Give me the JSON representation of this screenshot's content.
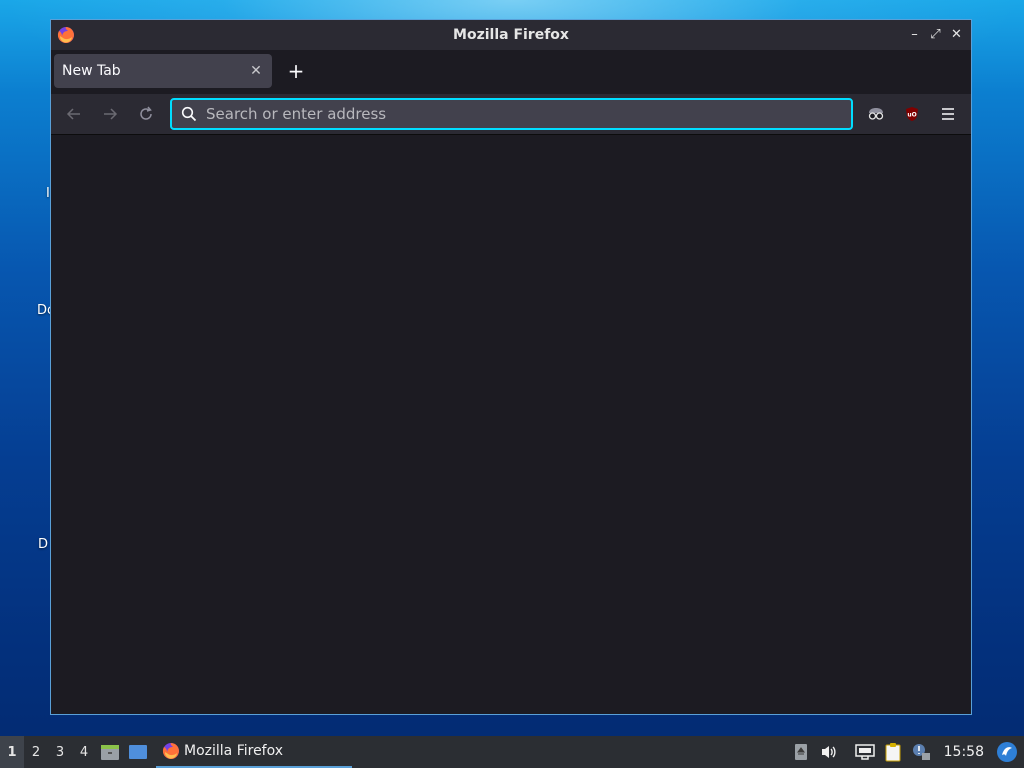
{
  "desktop": {
    "labels": [
      "I",
      "Do",
      "D"
    ]
  },
  "window": {
    "title": "Mozilla Firefox",
    "controls": {
      "minimize": "–",
      "maximize": "⤢",
      "close": "✕"
    }
  },
  "tabs": [
    {
      "label": "New Tab",
      "close": "✕"
    }
  ],
  "new_tab_label": "+",
  "navbar": {
    "back_icon": "arrow-left-icon",
    "forward_icon": "arrow-right-icon",
    "reload_icon": "reload-icon",
    "url_placeholder": "Search or enter address",
    "url_value": ""
  },
  "extensions": [
    "private-browsing-mask-icon",
    "ublock-origin-icon",
    "hamburger-menu-icon"
  ],
  "taskbar": {
    "workspaces": [
      "1",
      "2",
      "3",
      "4"
    ],
    "active_workspace": "1",
    "task_label": "Mozilla Firefox",
    "clock": "15:58"
  },
  "colors": {
    "accent": "#00ddff",
    "window_bg": "#1c1b22",
    "toolbar_bg": "#2b2a33",
    "tab_bg": "#42414d"
  }
}
